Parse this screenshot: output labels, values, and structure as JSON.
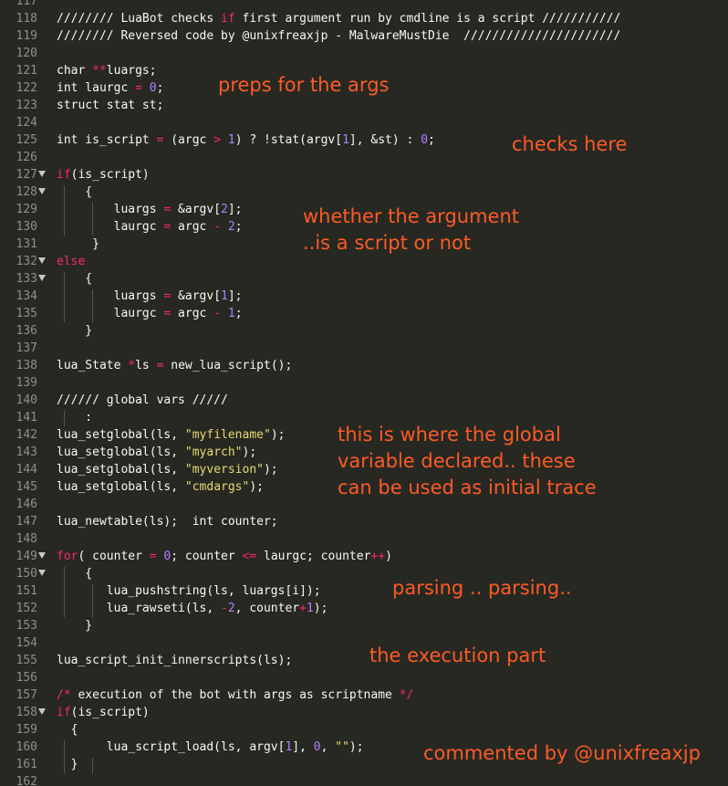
{
  "editor": {
    "theme_colors": {
      "background": "#272822",
      "text": "#f8f8f2",
      "keyword": "#f92672",
      "number": "#ae81ff",
      "string": "#e6db74",
      "line_number": "#8f908a",
      "annotation": "#fd5b25"
    },
    "lines": [
      {
        "n": "117",
        "fold": false,
        "tokens": []
      },
      {
        "n": "118",
        "fold": false,
        "tokens": [
          [
            "com",
            "//////// LuaBot checks "
          ],
          [
            "key",
            "if"
          ],
          [
            "com",
            " first argument run by cmdline is a script ///////////"
          ]
        ]
      },
      {
        "n": "119",
        "fold": false,
        "tokens": [
          [
            "com",
            "//////// Reversed code by @unixfreaxjp - MalwareMustDie  //////////////////////"
          ]
        ]
      },
      {
        "n": "120",
        "fold": false,
        "tokens": []
      },
      {
        "n": "121",
        "fold": false,
        "tokens": [
          [
            "fn",
            "char "
          ],
          [
            "key",
            "**"
          ],
          [
            "fn",
            "luargs;"
          ]
        ]
      },
      {
        "n": "122",
        "fold": false,
        "tokens": [
          [
            "fn",
            "int laurgc "
          ],
          [
            "key",
            "="
          ],
          [
            "fn",
            " "
          ],
          [
            "num",
            "0"
          ],
          [
            "fn",
            ";"
          ]
        ]
      },
      {
        "n": "123",
        "fold": false,
        "tokens": [
          [
            "fn",
            "struct stat st;"
          ]
        ]
      },
      {
        "n": "124",
        "fold": false,
        "tokens": []
      },
      {
        "n": "125",
        "fold": false,
        "tokens": [
          [
            "fn",
            "int is_script "
          ],
          [
            "key",
            "="
          ],
          [
            "fn",
            " (argc "
          ],
          [
            "key",
            ">"
          ],
          [
            "fn",
            " "
          ],
          [
            "num",
            "1"
          ],
          [
            "fn",
            ") ? !stat(argv["
          ],
          [
            "num",
            "1"
          ],
          [
            "fn",
            "], &st) : "
          ],
          [
            "num",
            "0"
          ],
          [
            "fn",
            ";"
          ]
        ]
      },
      {
        "n": "126",
        "fold": false,
        "tokens": []
      },
      {
        "n": "127",
        "fold": true,
        "tokens": [
          [
            "key",
            "if"
          ],
          [
            "fn",
            "(is_script)"
          ]
        ]
      },
      {
        "n": "128",
        "fold": true,
        "tokens": [
          [
            "fn",
            "    {"
          ]
        ]
      },
      {
        "n": "129",
        "fold": false,
        "tokens": [
          [
            "fn",
            "        luargs "
          ],
          [
            "key",
            "="
          ],
          [
            "fn",
            " &argv["
          ],
          [
            "num",
            "2"
          ],
          [
            "fn",
            "];"
          ]
        ]
      },
      {
        "n": "130",
        "fold": false,
        "tokens": [
          [
            "fn",
            "        laurgc "
          ],
          [
            "key",
            "="
          ],
          [
            "fn",
            " argc "
          ],
          [
            "key",
            "-"
          ],
          [
            "fn",
            " "
          ],
          [
            "num",
            "2"
          ],
          [
            "fn",
            ";"
          ]
        ]
      },
      {
        "n": "131",
        "fold": false,
        "tokens": [
          [
            "fn",
            "     }"
          ]
        ]
      },
      {
        "n": "132",
        "fold": true,
        "tokens": [
          [
            "key",
            "else"
          ]
        ]
      },
      {
        "n": "133",
        "fold": true,
        "tokens": [
          [
            "fn",
            "    {"
          ]
        ]
      },
      {
        "n": "134",
        "fold": false,
        "tokens": [
          [
            "fn",
            "        luargs "
          ],
          [
            "key",
            "="
          ],
          [
            "fn",
            " &argv["
          ],
          [
            "num",
            "1"
          ],
          [
            "fn",
            "];"
          ]
        ]
      },
      {
        "n": "135",
        "fold": false,
        "tokens": [
          [
            "fn",
            "        laurgc "
          ],
          [
            "key",
            "="
          ],
          [
            "fn",
            " argc "
          ],
          [
            "key",
            "-"
          ],
          [
            "fn",
            " "
          ],
          [
            "num",
            "1"
          ],
          [
            "fn",
            ";"
          ]
        ]
      },
      {
        "n": "136",
        "fold": false,
        "tokens": [
          [
            "fn",
            "    }"
          ]
        ]
      },
      {
        "n": "137",
        "fold": false,
        "tokens": []
      },
      {
        "n": "138",
        "fold": false,
        "tokens": [
          [
            "fn",
            "lua_State "
          ],
          [
            "key",
            "*"
          ],
          [
            "fn",
            "ls "
          ],
          [
            "key",
            "="
          ],
          [
            "fn",
            " new_lua_script();"
          ]
        ]
      },
      {
        "n": "139",
        "fold": false,
        "tokens": []
      },
      {
        "n": "140",
        "fold": false,
        "tokens": [
          [
            "com",
            "////// global vars /////"
          ]
        ]
      },
      {
        "n": "141",
        "fold": false,
        "tokens": [
          [
            "fn",
            "    :"
          ]
        ]
      },
      {
        "n": "142",
        "fold": false,
        "tokens": [
          [
            "fn",
            "lua_setglobal(ls, "
          ],
          [
            "str",
            "\"myfilename\""
          ],
          [
            "fn",
            ");"
          ]
        ]
      },
      {
        "n": "143",
        "fold": false,
        "tokens": [
          [
            "fn",
            "lua_setglobal(ls, "
          ],
          [
            "str",
            "\"myarch\""
          ],
          [
            "fn",
            ");"
          ]
        ]
      },
      {
        "n": "144",
        "fold": false,
        "tokens": [
          [
            "fn",
            "lua_setglobal(ls, "
          ],
          [
            "str",
            "\"myversion\""
          ],
          [
            "fn",
            ");"
          ]
        ]
      },
      {
        "n": "145",
        "fold": false,
        "tokens": [
          [
            "fn",
            "lua_setglobal(ls, "
          ],
          [
            "str",
            "\"cmdargs\""
          ],
          [
            "fn",
            ");"
          ]
        ]
      },
      {
        "n": "146",
        "fold": false,
        "tokens": []
      },
      {
        "n": "147",
        "fold": false,
        "tokens": [
          [
            "fn",
            "lua_newtable(ls);  int counter;"
          ]
        ]
      },
      {
        "n": "148",
        "fold": false,
        "tokens": []
      },
      {
        "n": "149",
        "fold": true,
        "tokens": [
          [
            "key",
            "for"
          ],
          [
            "fn",
            "( counter "
          ],
          [
            "key",
            "="
          ],
          [
            "fn",
            " "
          ],
          [
            "num",
            "0"
          ],
          [
            "fn",
            "; counter "
          ],
          [
            "key",
            "<="
          ],
          [
            "fn",
            " laurgc; counter"
          ],
          [
            "key",
            "++"
          ],
          [
            "fn",
            ")"
          ]
        ]
      },
      {
        "n": "150",
        "fold": true,
        "tokens": [
          [
            "fn",
            "    {"
          ]
        ]
      },
      {
        "n": "151",
        "fold": false,
        "tokens": [
          [
            "fn",
            "       lua_pushstring(ls, luargs[i]);"
          ]
        ]
      },
      {
        "n": "152",
        "fold": false,
        "tokens": [
          [
            "fn",
            "       lua_rawseti(ls, "
          ],
          [
            "key",
            "-"
          ],
          [
            "num",
            "2"
          ],
          [
            "fn",
            ", counter"
          ],
          [
            "key",
            "+"
          ],
          [
            "num",
            "1"
          ],
          [
            "fn",
            ");"
          ]
        ]
      },
      {
        "n": "153",
        "fold": false,
        "tokens": [
          [
            "fn",
            "    }"
          ]
        ]
      },
      {
        "n": "154",
        "fold": false,
        "tokens": []
      },
      {
        "n": "155",
        "fold": false,
        "tokens": [
          [
            "fn",
            "lua_script_init_innerscripts(ls);"
          ]
        ]
      },
      {
        "n": "156",
        "fold": false,
        "tokens": []
      },
      {
        "n": "157",
        "fold": false,
        "tokens": [
          [
            "key",
            "/*"
          ],
          [
            "fn",
            " execution of the bot with args as scriptname "
          ],
          [
            "key",
            "*/"
          ]
        ]
      },
      {
        "n": "158",
        "fold": true,
        "tokens": [
          [
            "key",
            "if"
          ],
          [
            "fn",
            "(is_script)"
          ]
        ]
      },
      {
        "n": "159",
        "fold": false,
        "tokens": [
          [
            "fn",
            "  {"
          ]
        ]
      },
      {
        "n": "160",
        "fold": false,
        "tokens": [
          [
            "fn",
            "       lua_script_load(ls, argv["
          ],
          [
            "num",
            "1"
          ],
          [
            "fn",
            "], "
          ],
          [
            "num",
            "0"
          ],
          [
            "fn",
            ", "
          ],
          [
            "str",
            "\"\""
          ],
          [
            "fn",
            ");"
          ]
        ]
      },
      {
        "n": "161",
        "fold": false,
        "tokens": [
          [
            "fn",
            "  }"
          ]
        ]
      },
      {
        "n": "162",
        "fold": false,
        "tokens": []
      }
    ]
  },
  "annotations": [
    {
      "text": "preps for the args"
    },
    {
      "text": "checks here"
    },
    {
      "text": "whether the argument"
    },
    {
      "text": "..is a script or not"
    },
    {
      "text": "this is where the global"
    },
    {
      "text": "variable declared.. these"
    },
    {
      "text": "can be used as initial trace"
    },
    {
      "text": "parsing .. parsing.."
    },
    {
      "text": "the execution part"
    },
    {
      "text": "commented by @unixfreaxjp"
    }
  ]
}
